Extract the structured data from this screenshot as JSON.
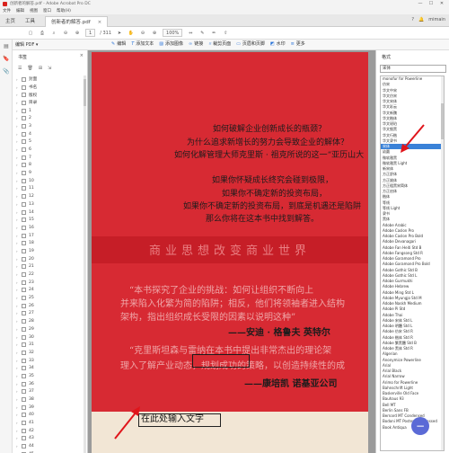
{
  "window": {
    "title": "创新者的解答.pdf - Adobe Acrobat Pro DC",
    "controls": [
      "—",
      "☐",
      "✕"
    ]
  },
  "menu": [
    "文件",
    "编辑",
    "视图",
    "窗口",
    "帮助(H)"
  ],
  "tabs": [
    {
      "label": "主页"
    },
    {
      "label": "工具"
    },
    {
      "label": "创新者的解答.pdf",
      "close": "×"
    }
  ],
  "account": "mimain",
  "toolbar": {
    "page_current": "1",
    "page_total": "/ 311",
    "zoom": "100%"
  },
  "editbar": {
    "label": "编辑 PDF ▾",
    "tools": [
      "编辑",
      "添加文本",
      "添加图像",
      "链接",
      "裁剪页面",
      "页眉和页脚",
      "水印",
      "更多"
    ]
  },
  "bookmarks": {
    "title": "书签",
    "close": "×",
    "items": [
      "封面",
      "书名",
      "版权",
      "目录",
      "1",
      "2",
      "3",
      "4",
      "5",
      "6",
      "7",
      "8",
      "9",
      "10",
      "11",
      "12",
      "13",
      "14",
      "15",
      "16",
      "17",
      "18",
      "19",
      "20",
      "21",
      "22",
      "23",
      "24",
      "25",
      "26",
      "27",
      "28",
      "29",
      "30",
      "31",
      "32",
      "33",
      "34",
      "35",
      "36",
      "37",
      "38",
      "39",
      "40",
      "41",
      "42",
      "43",
      "44",
      "45",
      "46",
      "47"
    ]
  },
  "document": {
    "line1": "如何破解企业创新成长的瓶颈？",
    "line2": "为什么追求新增长的努力会导致企业的解体？",
    "line3": "如何化解管理大师克里斯 · 祖克所说的这一“亚历山大",
    "line4": "如果你怀疑成长终究会碰到极限，",
    "line5": "如果你不确定新的投资布局，",
    "line6": "如果你不确定新的投资布局，到底是机遇还是陷阱",
    "line7": "那么你将在这本书中找到解答。",
    "band": "商业思想改变商业世界",
    "q1a": "“本书探究了企业的挑战：如何让组织不断向上",
    "q1b": "并来陷入化繁为简的陷阱；相反，他们将领袖者进入结构",
    "q1c": "架构，指出组织成长受限的因素以说明这种”",
    "sig1": "——安迪 · 格鲁夫   英特尔",
    "q2a": "“克里斯坦森与雷纳在本书中提出非常杰出的理论架",
    "q2b": "理入了解产业动态，规划成功的策略，以创造持续性的成",
    "sig2": "——康培凯   诺基亚公司",
    "input_text": "在此处输入文字"
  },
  "format": {
    "title": "格式",
    "font_value": "宋体",
    "fonts": [
      "monofur for Powerline",
      "仿宋",
      "华文中宋",
      "华文仿宋",
      "华文宋体",
      "华文彩云",
      "华文新魏",
      "华文楷体",
      "华文琥珀",
      "华文细黑",
      "华文行楷",
      "华文隶书",
      "宋体",
      "幼圆",
      "微软雅黑",
      "微软雅黑 Light",
      "新宋体",
      "方正舒体",
      "方正姚体",
      "方正粗黑宋简体",
      "方正启体",
      "楷体",
      "等线",
      "等线 Light",
      "隶书",
      "黑体",
      "Adobe Arabic",
      "Adobe Caslon Pro",
      "Adobe Caslon Pro Bold",
      "Adobe Devanagari",
      "Adobe Fan Heiti Std B",
      "Adobe Fangsong Std R",
      "Adobe Garamond Pro",
      "Adobe Garamond Pro Bold",
      "Adobe Gothic Std B",
      "Adobe Gothic Std L",
      "Adobe Gurmukhi",
      "Adobe Hebrew",
      "Adobe Ming Std L",
      "Adobe Myungjo Std M",
      "Adobe Naskh Medium",
      "Adobe Pi Std",
      "Adobe Thai",
      "Adobe 宋体 Std L",
      "Adobe 明體 Std L",
      "Adobe 仿宋 Std R",
      "Adobe 楷体 Std R",
      "Adobe 繁黑體 Std B",
      "Adobe 黑体 Std R",
      "Algerian",
      "Anonymice Powerline",
      "Arial",
      "Arial Black",
      "Arial Narrow",
      "Arimo for Powerline",
      "Bahnschrift Light",
      "Baskerville Old Face",
      "Bauhaus 93",
      "Bell MT",
      "Berlin Sans FB",
      "Bernard MT Condensed",
      "Bodoni MT Poster Compressed",
      "Book Antiqua"
    ],
    "selected_index": 12
  },
  "colors": {
    "book_red": "#d72a33",
    "accent": "#2b74d8",
    "selection": "#3a82d8",
    "annotation": "#e0151b"
  }
}
